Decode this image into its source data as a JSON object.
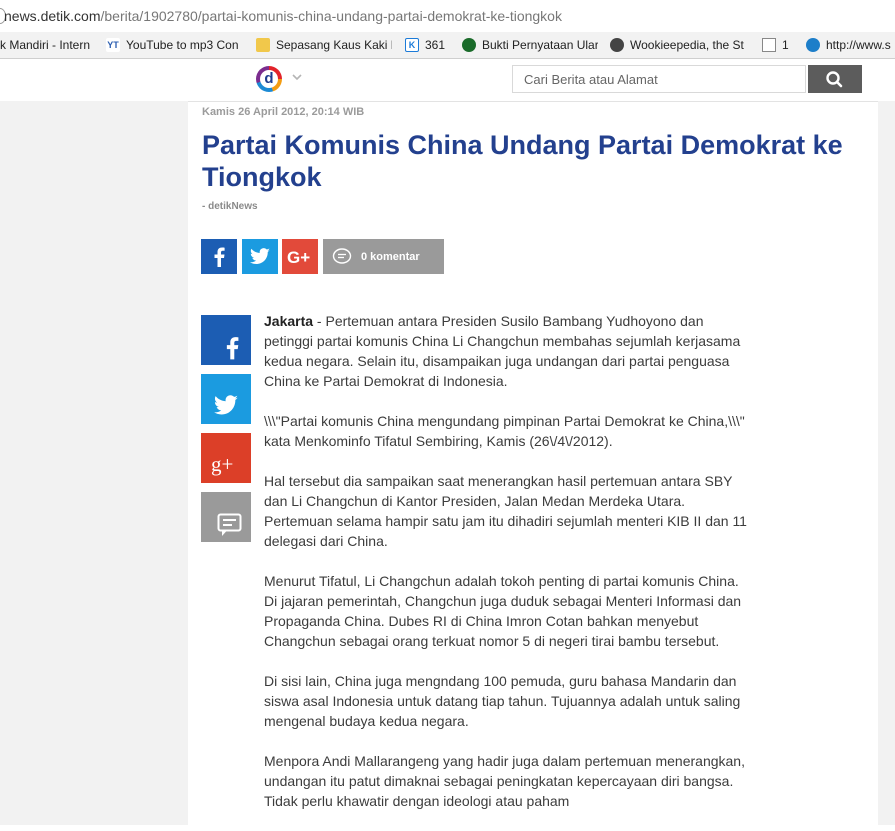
{
  "browser": {
    "url_domain": "news.detik.com",
    "url_path": "/berita/1902780/partai-komunis-china-undang-partai-demokrat-ke-tiongkok",
    "bookmarks": [
      {
        "label": "k Mandiri - Intern"
      },
      {
        "label": "YouTube to mp3 Con"
      },
      {
        "label": "Sepasang Kaus Kaki H"
      },
      {
        "label": "361"
      },
      {
        "label": "Bukti Pernyataan Ular"
      },
      {
        "label": "Wookieepedia, the St"
      },
      {
        "label": "1"
      },
      {
        "label": "http://www.s"
      }
    ]
  },
  "site": {
    "logo_letter": "d",
    "search_placeholder": "Cari Berita atau Alamat"
  },
  "article": {
    "date": "Kamis 26 April 2012, 20:14 WIB",
    "title": "Partai Komunis China Undang Partai Demokrat ke Tiongkok",
    "source": "- detikNews",
    "comment_count": "0 komentar",
    "location": "Jakarta",
    "lead": " - Pertemuan antara Presiden Susilo Bambang Yudhoyono dan petinggi partai komunis China Li Changchun membahas sejumlah kerjasama kedua negara. Selain itu, disampaikan juga undangan dari partai penguasa China ke Partai Demokrat di Indonesia.",
    "paragraphs": [
      "\\\\\\\"Partai komunis China mengundang pimpinan Partai Demokrat ke China,\\\\\\\" kata Menkominfo Tifatul Sembiring, Kamis (26\\/4\\/2012).",
      "Hal tersebut dia sampaikan saat menerangkan hasil pertemuan antara SBY dan Li Changchun di Kantor Presiden, Jalan Medan Merdeka Utara. Pertemuan selama hampir satu jam itu dihadiri sejumlah menteri KIB II dan 11 delegasi dari China.",
      "Menurut Tifatul, Li Changchun adalah tokoh penting di partai komunis China. Di jajaran pemerintah, Changchun juga duduk sebagai Menteri Informasi dan Propaganda China. Dubes RI di China Imron Cotan bahkan menyebut Changchun sebagai orang terkuat nomor 5 di negeri tirai bambu tersebut.",
      "Di sisi lain, China juga mengndang 100 pemuda, guru bahasa Mandarin dan siswa asal Indonesia untuk datang tiap tahun. Tujuannya adalah untuk saling mengenal budaya kedua negara.",
      "Menpora Andi Mallarangeng yang hadir juga dalam pertemuan menerangkan, undangan itu patut dimaknai sebagai peningkatan kepercayaan diri bangsa. Tidak perlu khawatir dengan ideologi atau paham"
    ]
  },
  "colors": {
    "title": "#23408e",
    "facebook": "#1c5db3",
    "twitter": "#1b9be0",
    "google_plus": "#e24a3a",
    "comment": "#9a9a9a"
  }
}
